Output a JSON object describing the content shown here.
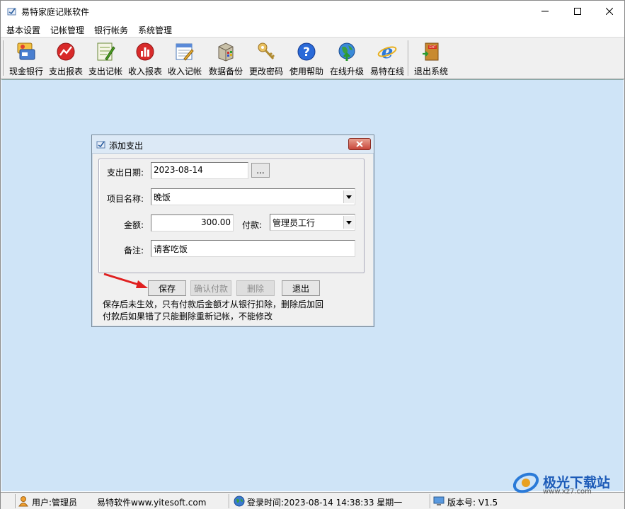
{
  "window": {
    "title": "易特家庭记账软件"
  },
  "menu": [
    "基本设置",
    "记帐管理",
    "银行帐务",
    "系统管理"
  ],
  "toolbar": [
    {
      "label": "现金银行",
      "icon": "cash-bank-icon"
    },
    {
      "label": "支出报表",
      "icon": "expense-report-icon"
    },
    {
      "label": "支出记帐",
      "icon": "expense-entry-icon"
    },
    {
      "label": "收入报表",
      "icon": "income-report-icon"
    },
    {
      "label": "收入记帐",
      "icon": "income-entry-icon"
    },
    {
      "label": "数据备份",
      "icon": "backup-icon"
    },
    {
      "label": "更改密码",
      "icon": "key-icon"
    },
    {
      "label": "使用帮助",
      "icon": "help-icon"
    },
    {
      "label": "在线升级",
      "icon": "upgrade-icon"
    },
    {
      "label": "易特在线",
      "icon": "ie-icon"
    },
    {
      "label": "退出系统",
      "icon": "exit-icon"
    }
  ],
  "dialog": {
    "title": "添加支出",
    "date_label": "支出日期:",
    "date_value": "2023-08-14",
    "date_button": "...",
    "item_label": "项目名称:",
    "item_value": "晚饭",
    "amount_label": "金额:",
    "amount_value": "300.00",
    "pay_label": "付款:",
    "pay_value": "管理员工行",
    "remark_label": "备注:",
    "remark_value": "请客吃饭",
    "buttons": {
      "save": "保存",
      "confirm": "确认付款",
      "delete": "删除",
      "exit": "退出"
    },
    "note1": "保存后未生效，只有付款后金额才从银行扣除，删除后加回",
    "note2": "付款后如果错了只能删除重新记帐，不能修改"
  },
  "status": {
    "user": "用户:管理员",
    "company": "易特软件www.yitesoft.com",
    "login": "登录时间:2023-08-14 14:38:33 星期一",
    "version": "版本号: V1.5"
  },
  "watermark": {
    "text": "极光下载站",
    "url": "www.xz7.com"
  },
  "colors": {
    "client_bg": "#cfe4f7",
    "dialog_title_bg": "#dce9f6",
    "arrow": "#e02020"
  }
}
